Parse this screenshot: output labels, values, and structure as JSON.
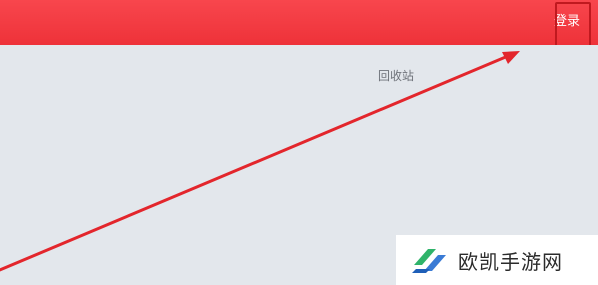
{
  "header": {
    "login_label": "登录"
  },
  "desktop": {
    "recycle_bin_label": "回收站"
  },
  "watermark": {
    "text": "欧凯手游网"
  },
  "colors": {
    "header_red": "#f0363d",
    "annotation_red": "#e3262c",
    "background": "#e3e7ec"
  }
}
